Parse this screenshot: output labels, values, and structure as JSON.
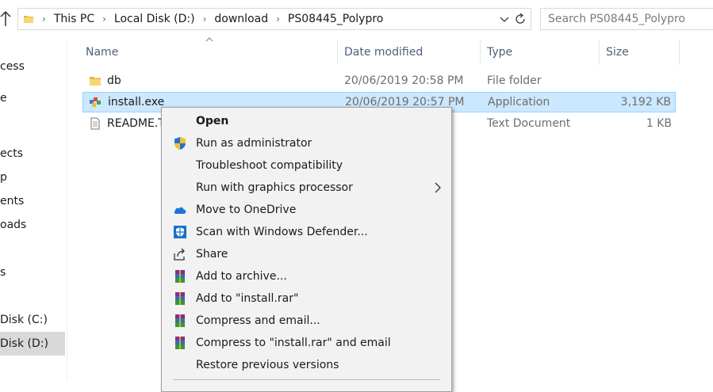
{
  "address_bar": {
    "crumbs": [
      "This PC",
      "Local Disk (D:)",
      "download",
      "PS08445_Polypro"
    ],
    "separator": "›"
  },
  "search": {
    "placeholder": "Search PS08445_Polypro"
  },
  "nav_pane": {
    "items": [
      {
        "label": "cess"
      },
      {
        "label": "e"
      },
      {
        "label": "ects"
      },
      {
        "label": "p"
      },
      {
        "label": "ents"
      },
      {
        "label": "oads"
      },
      {
        "label": "s"
      },
      {
        "label": "Disk (C:)"
      },
      {
        "label": "Disk (D:)",
        "selected": true
      }
    ]
  },
  "columns": {
    "name": "Name",
    "date": "Date modified",
    "type": "Type",
    "size": "Size"
  },
  "files": [
    {
      "name": "db",
      "date": "20/06/2019 20:58 PM",
      "type": "File folder",
      "size": "",
      "icon": "folder-icon"
    },
    {
      "name": "install.exe",
      "date": "20/06/2019 20:57 PM",
      "type": "Application",
      "size": "3,192 KB",
      "icon": "installer-icon",
      "selected": true
    },
    {
      "name": "README.T",
      "date": "",
      "type": "Text Document",
      "size": "1 KB",
      "icon": "text-document-icon"
    }
  ],
  "context_menu": {
    "items": [
      {
        "label": "Open",
        "bold": true,
        "icon": ""
      },
      {
        "label": "Run as administrator",
        "icon": "uac-shield-icon"
      },
      {
        "label": "Troubleshoot compatibility",
        "icon": ""
      },
      {
        "label": "Run with graphics processor",
        "icon": "",
        "submenu": true
      },
      {
        "label": "Move to OneDrive",
        "icon": "onedrive-cloud-icon"
      },
      {
        "label": "Scan with Windows Defender...",
        "icon": "defender-shield-icon"
      },
      {
        "label": "Share",
        "icon": "share-icon"
      },
      {
        "label": "Add to archive...",
        "icon": "winrar-icon"
      },
      {
        "label": "Add to \"install.rar\"",
        "icon": "winrar-icon"
      },
      {
        "label": "Compress and email...",
        "icon": "winrar-icon"
      },
      {
        "label": "Compress to \"install.rar\" and email",
        "icon": "winrar-icon"
      },
      {
        "label": "Restore previous versions",
        "icon": ""
      }
    ]
  },
  "colors": {
    "selection_bg": "#cce8ff",
    "selection_border": "#99d1ff",
    "header_text": "#4c607a",
    "menu_bg": "#f2f2f2"
  }
}
